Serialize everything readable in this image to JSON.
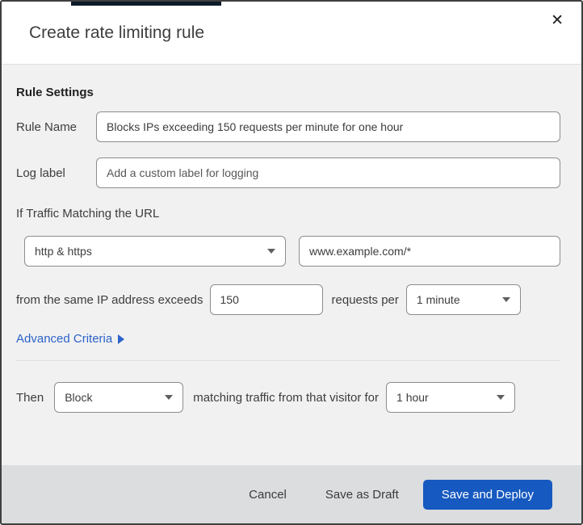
{
  "dialog": {
    "title": "Create rate limiting rule",
    "close_icon": "✕"
  },
  "rule_settings": {
    "heading": "Rule Settings",
    "rule_name": {
      "label": "Rule Name",
      "value": "Blocks IPs exceeding 150 requests per minute for one hour"
    },
    "log_label": {
      "label": "Log label",
      "placeholder": "Add a custom label for logging"
    }
  },
  "traffic_match": {
    "heading": "If Traffic Matching the URL",
    "scheme_select": {
      "value": "http & https"
    },
    "url_input": {
      "value": "www.example.com/*"
    },
    "threshold": {
      "prefix": "from the same IP address exceeds",
      "requests_value": "150",
      "middle": "requests per",
      "period_select": {
        "value": "1 minute"
      }
    },
    "advanced_criteria": {
      "label": "Advanced Criteria"
    }
  },
  "then_clause": {
    "label": "Then",
    "action_select": {
      "value": "Block"
    },
    "middle": "matching traffic from that visitor for",
    "duration_select": {
      "value": "1 hour"
    }
  },
  "footer": {
    "cancel": "Cancel",
    "save_draft": "Save as Draft",
    "save_deploy": "Save and Deploy"
  },
  "colors": {
    "link_blue": "#2c62c9",
    "deploy_button_blue": "#1659c0",
    "footer_gray": "#dcddde",
    "body_gray": "#f1f1f2",
    "top_sliver_navy": "#0d1b2a"
  }
}
